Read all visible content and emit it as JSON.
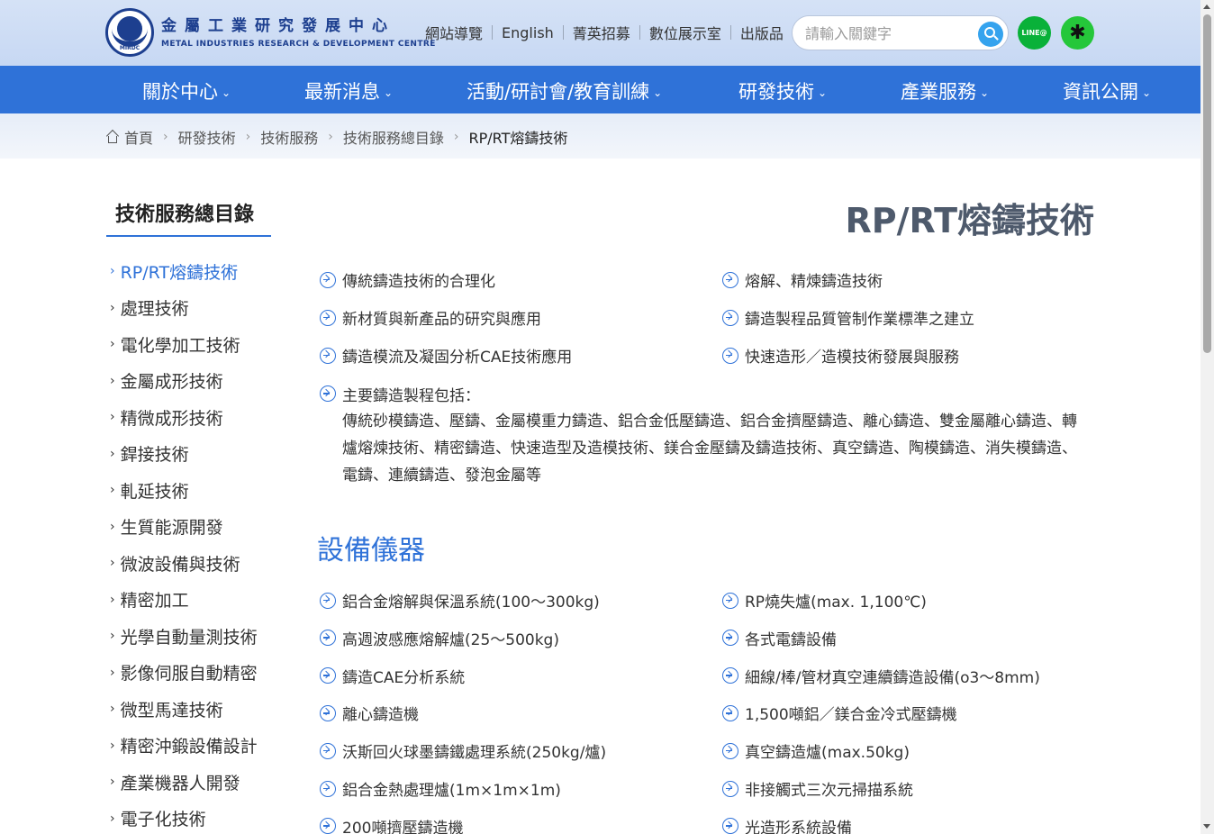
{
  "header": {
    "logo_zh": "金屬工業研究發展中心",
    "logo_en": "METAL INDUSTRIES RESEARCH & DEVELOPMENT CENTRE",
    "logo_badge": "MIRDC",
    "top_links": [
      "網站導覽",
      "English",
      "菁英招募",
      "數位展示室",
      "出版品"
    ],
    "search_placeholder": "請輸入關鍵字",
    "line_label": "LINE@",
    "other_label": "✱"
  },
  "nav": {
    "items": [
      "關於中心",
      "最新消息",
      "活動/研討會/教育訓練",
      "研發技術",
      "產業服務",
      "資訊公開"
    ],
    "chevron": "⌄"
  },
  "breadcrumb": {
    "items": [
      "首頁",
      "研發技術",
      "技術服務",
      "技術服務總目錄",
      "RP/RT熔鑄技術"
    ],
    "separator": "›"
  },
  "sidebar": {
    "title": "技術服務總目錄",
    "marker": "›",
    "items": [
      "RP/RT熔鑄技術",
      "處理技術",
      "電化學加工技術",
      "金屬成形技術",
      "精微成形技術",
      "銲接技術",
      "軋延技術",
      "生質能源開發",
      "微波設備與技術",
      "精密加工",
      "光學自動量測技術",
      "影像伺服自動精密",
      "微型馬達技術",
      "精密沖鍛設備設計",
      "產業機器人開發",
      "電子化技術"
    ],
    "active_index": 0
  },
  "content": {
    "title": "RP/RT熔鑄技術",
    "services": [
      [
        "傳統鑄造技術的合理化",
        "熔解、精煉鑄造技術"
      ],
      [
        "新材質與新產品的研究與應用",
        "鑄造製程品質管制作業標準之建立"
      ],
      [
        "鑄造模流及凝固分析CAE技術應用",
        "快速造形／造模技術發展與服務"
      ]
    ],
    "processes_head": "主要鑄造製程包括：",
    "processes_body": "傳統砂模鑄造、壓鑄、金屬模重力鑄造、鋁合金低壓鑄造、鋁合金擠壓鑄造、離心鑄造、雙金屬離心鑄造、轉爐熔煉技術、精密鑄造、快速造型及造模技術、鎂合金壓鑄及鑄造技術、真空鑄造、陶模鑄造、消失模鑄造、電鑄、連續鑄造、發泡金屬等",
    "equipment_title": "設備儀器",
    "equipment": [
      [
        "鋁合金熔解與保溫系統(100～300kg)",
        "RP燒失爐(max. 1,100℃)"
      ],
      [
        "高週波感應熔解爐(25～500kg)",
        "各式電鑄設備"
      ],
      [
        "鑄造CAE分析系統",
        "細線/棒/管材真空連續鑄造設備(o3～8mm)"
      ],
      [
        "離心鑄造機",
        "1,500噸鋁／鎂合金冷式壓鑄機"
      ],
      [
        "沃斯回火球墨鑄鐵處理系統(250kg/爐)",
        "真空鑄造爐(max.50kg)"
      ],
      [
        "鋁合金熱處理爐(1m×1m×1m)",
        "非接觸式三次元掃描系統"
      ],
      [
        "200噸擠壓鑄造機",
        "光造形系統設備"
      ]
    ]
  },
  "colors": {
    "primary": "#2f72d8",
    "header_bg": "#c7d8f3",
    "title": "#4e5a6c"
  }
}
